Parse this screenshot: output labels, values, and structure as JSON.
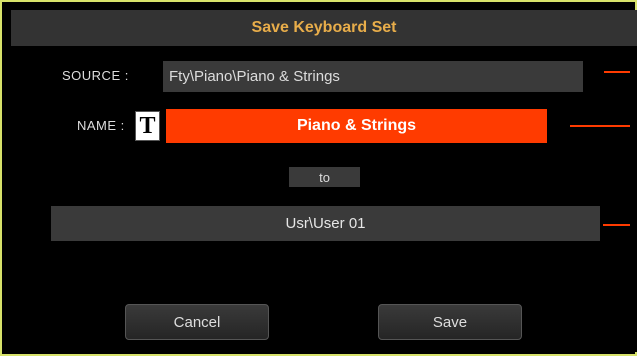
{
  "dialog": {
    "title": "Save Keyboard Set",
    "source_label": "SOURCE :",
    "source_value": "Fty\\Piano\\Piano & Strings",
    "name_label": "NAME :",
    "name_text_edit_icon": "T",
    "name_value": "Piano & Strings",
    "to_label": "to",
    "destination_value": "Usr\\User 01",
    "cancel_label": "Cancel",
    "save_label": "Save"
  },
  "colors": {
    "title_text": "#e8ad4a",
    "accent": "#ff3b00",
    "frame": "#d7e26a"
  }
}
